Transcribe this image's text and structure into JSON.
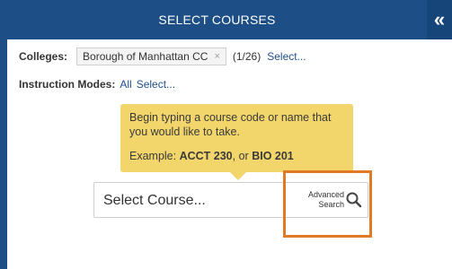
{
  "header": {
    "title": "SELECT COURSES",
    "collapse_glyph": "«"
  },
  "colleges": {
    "label": "Colleges:",
    "chip_label": "Borough of Manhattan CC",
    "chip_remove_glyph": "×",
    "count": "(1/26)",
    "select_link": "Select..."
  },
  "modes": {
    "label": "Instruction Modes:",
    "value": "All",
    "select_link": "Select..."
  },
  "tooltip": {
    "line1": "Begin typing a course code or name that",
    "line2": "you would like to take.",
    "example_prefix": "Example: ",
    "example_a": "ACCT 230",
    "example_mid": ", or ",
    "example_b": "BIO 201"
  },
  "search": {
    "placeholder": "Select Course...",
    "advanced_line1": "Advanced",
    "advanced_line2": "Search"
  },
  "icons": {
    "search": "search-icon",
    "collapse": "double-chevron-left-icon"
  },
  "colors": {
    "header": "#1d4f86",
    "tooltip": "#f3d66b",
    "highlight": "#e07a24",
    "link": "#1f4f8e"
  }
}
